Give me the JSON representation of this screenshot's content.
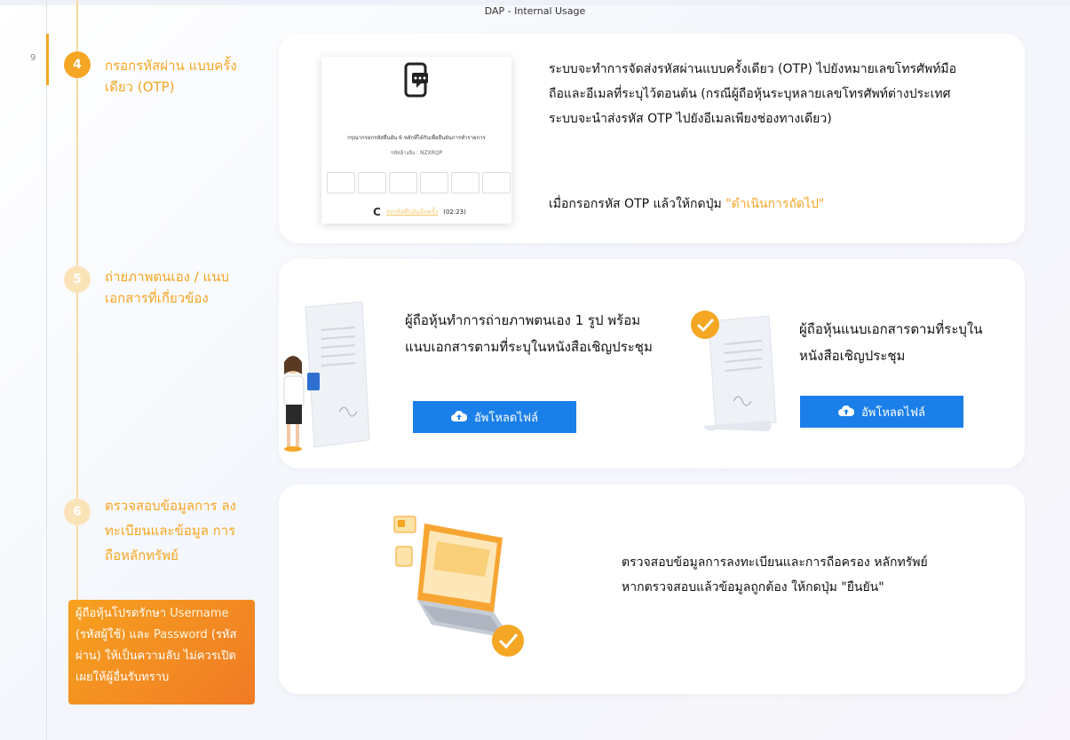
{
  "header": {
    "text": "DAP - Internal Usage"
  },
  "page_number": "9",
  "steps": [
    {
      "number": "4",
      "title": "กรอกรหัสผ่าน แบบครั้งเดียว (OTP)",
      "description": "ระบบจะทำการจัดส่งรหัสผ่านแบบครั้งเดียว (OTP) ไปยังหมายเลขโทรศัพท์มือถือและอีเมลที่ระบุไว้ตอนต้น (กรณีผู้ถือหุ้นระบุหลายเลขโทรศัพท์ต่างประเทศ ระบบจะนำส่งรหัส OTP ไปยังอีเมลเพียงช่องทางเดียว)",
      "instruction_prefix": "เมื่อกรอกรหัส OTP แล้วให้กดปุ่ม ",
      "instruction_action": "\"ดำเนินการถัดไป\"",
      "otp_form": {
        "title": "กรุณากรอกรหัสยืนยัน 6 หลักที่ได้รับเพื่อยืนยันการทำรายการ",
        "reference": "รหัสอ้างอิง : NZXRQP",
        "resend_label": "ส่งรหัสยืนยันอีกครั้ง",
        "timer": "(02:23)",
        "resend_icon": "refresh-icon",
        "phone_icon": "phone-chat-icon"
      }
    },
    {
      "number": "5",
      "title": "ถ่ายภาพตนเอง / แนบเอกสารที่เกี่ยวข้อง",
      "left_description": "ผู้ถือหุ้นทำการถ่ายภาพตนเอง 1 รูป พร้อมแนบเอกสารตามที่ระบุในหนังสือเชิญประชุม",
      "right_description": "ผู้ถือหุ้นแนบเอกสารตามที่ระบุใน หนังสือเชิญประชุม",
      "upload_label": "อัพโหลดไฟล์",
      "upload_icon": "cloud-upload-icon"
    },
    {
      "number": "6",
      "title": "ตรวจสอบข้อมูลการ ลงทะเบียนและข้อมูล การถือหลักทรัพย์",
      "description": "ตรวจสอบข้อมูลการลงทะเบียนและการถือครอง หลักทรัพย์ หากตรวจสอบแล้วข้อมูลถูกต้อง ให้กดปุ่ม \"ยืนยัน\""
    }
  ],
  "note": {
    "part1": "ผู้ถือหุ้นโปรดรักษา ",
    "username": "Username",
    "part2": " (รหัสผู้ใช้) และ ",
    "password": "Password",
    "part3": " (รหัสผ่าน) ให้เป็นความลับ ไม่ควรเปิดเผยให้ผู้อื่นรับทราบ"
  },
  "colors": {
    "accent": "#f5a623",
    "button": "#1a7fe8",
    "note_bg": "#f39121"
  }
}
